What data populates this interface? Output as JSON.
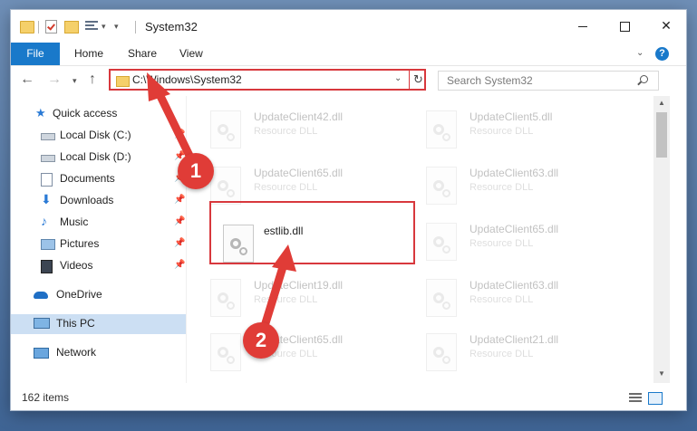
{
  "window": {
    "title": "System32",
    "minimize_glyph": "",
    "close_glyph": "✕"
  },
  "ribbon": {
    "file": "File",
    "home": "Home",
    "share": "Share",
    "view": "View",
    "help": "?"
  },
  "nav": {
    "back": "←",
    "forward": "→",
    "up": "↑",
    "address": "C:\\Windows\\System32",
    "search_placeholder": "Search System32"
  },
  "sidebar": {
    "items": [
      {
        "label": "Quick access",
        "icon": "star-icon",
        "pinned": false
      },
      {
        "label": "Local Disk (C:)",
        "icon": "drive-icon",
        "pinned": true
      },
      {
        "label": "Local Disk (D:)",
        "icon": "drive-icon",
        "pinned": true
      },
      {
        "label": "Documents",
        "icon": "documents-icon",
        "pinned": true
      },
      {
        "label": "Downloads",
        "icon": "download-icon",
        "pinned": true
      },
      {
        "label": "Music",
        "icon": "music-icon",
        "pinned": true
      },
      {
        "label": "Pictures",
        "icon": "pictures-icon",
        "pinned": true
      },
      {
        "label": "Videos",
        "icon": "videos-icon",
        "pinned": true
      },
      {
        "label": "OneDrive",
        "icon": "cloud-icon",
        "pinned": false
      },
      {
        "label": "This PC",
        "icon": "computer-icon",
        "pinned": false
      },
      {
        "label": "Network",
        "icon": "network-icon",
        "pinned": false
      }
    ]
  },
  "files": [
    {
      "name": "UpdateClient42.dll",
      "type": "Resource DLL"
    },
    {
      "name": "UpdateClient5.dll",
      "type": "Resource DLL"
    },
    {
      "name": "UpdateClient65.dll",
      "type": "Resource DLL"
    },
    {
      "name": "UpdateClient63.dll",
      "type": "Resource DLL"
    },
    {
      "name": "estlib.dll",
      "type": ""
    },
    {
      "name": "UpdateClient65.dll",
      "type": "Resource DLL"
    },
    {
      "name": "UpdateClient19.dll",
      "type": "Resource DLL"
    },
    {
      "name": "UpdateClient63.dll",
      "type": "Resource DLL"
    },
    {
      "name": "UpdateClient65.dll",
      "type": "Resource DLL"
    },
    {
      "name": "UpdateClient21.dll",
      "type": "Resource DLL"
    }
  ],
  "status": {
    "items_count": "162 items"
  },
  "callouts": {
    "step1": "1",
    "step2": "2"
  },
  "colors": {
    "accent": "#1979ca",
    "highlight": "#d8383d",
    "selected": "#ccdff3"
  }
}
